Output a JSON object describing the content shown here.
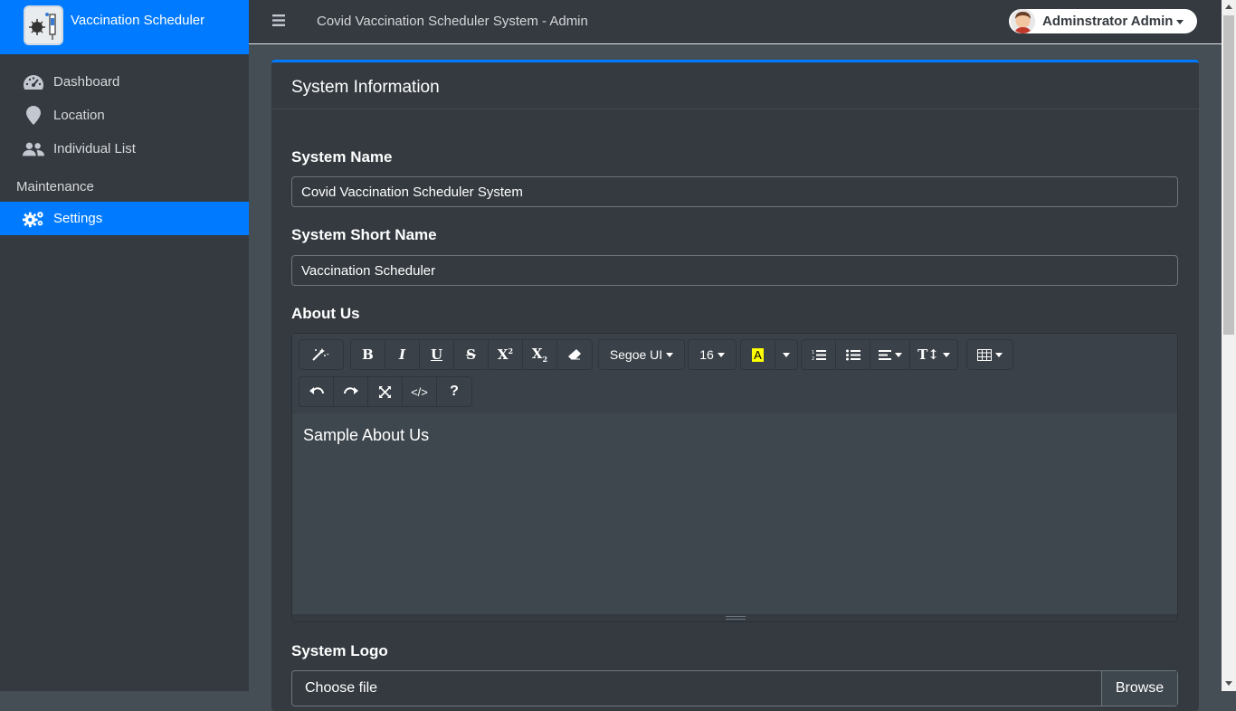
{
  "brand": {
    "title": "Vaccination Scheduler",
    "logo_icon": "vaccine-logo-icon"
  },
  "sidebar": {
    "items": [
      {
        "label": "Dashboard",
        "icon": "tachometer-icon"
      },
      {
        "label": "Location",
        "icon": "map-marker-icon"
      },
      {
        "label": "Individual List",
        "icon": "users-icon"
      }
    ],
    "section_header": "Maintenance",
    "maintenance_items": [
      {
        "label": "Settings",
        "icon": "gears-icon",
        "active": true
      }
    ]
  },
  "topbar": {
    "title": "Covid Vaccination Scheduler System - Admin",
    "user_name": "Adminstrator Admin"
  },
  "card": {
    "title": "System Information"
  },
  "form": {
    "system_name_label": "System Name",
    "system_name_value": "Covid Vaccination Scheduler System",
    "short_name_label": "System Short Name",
    "short_name_value": "Vaccination Scheduler",
    "about_label": "About Us",
    "about_content": "Sample About Us",
    "logo_label": "System Logo",
    "file_placeholder": "Choose file",
    "browse_label": "Browse"
  },
  "editor_toolbar": {
    "font_name": "Segoe UI",
    "font_size": "16",
    "highlight_letter": "A",
    "highlight_color": "#ffff00"
  },
  "colors": {
    "accent": "#007bff",
    "sidebar_bg": "#343a40",
    "content_bg": "#454d55"
  }
}
